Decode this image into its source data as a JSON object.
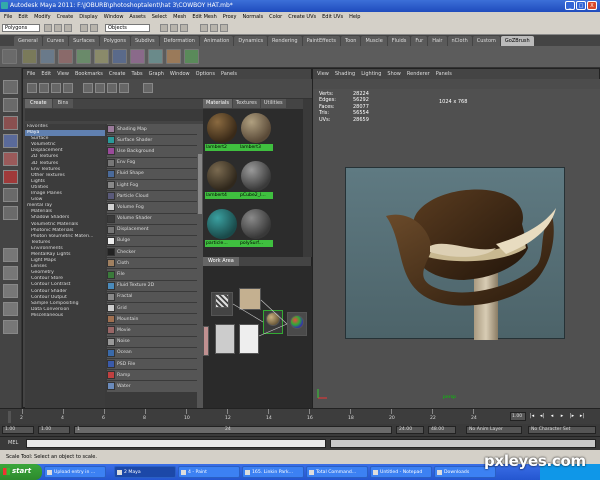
{
  "window": {
    "title": "Autodesk Maya 2011: F:\\JOBURB\\photoshoptalent\\hat 3\\COWBOY HAT.mb*",
    "min": "_",
    "max": "□",
    "close": "X"
  },
  "menubar": [
    "File",
    "Edit",
    "Modify",
    "Create",
    "Display",
    "Window",
    "Assets",
    "Select",
    "Mesh",
    "Edit Mesh",
    "Proxy",
    "Normals",
    "Color",
    "Create UVs",
    "Edit UVs",
    "Help"
  ],
  "statusline": {
    "mode": "Polygons",
    "search_label": "Objects"
  },
  "shelf_tabs": [
    "General",
    "Curves",
    "Surfaces",
    "Polygons",
    "Subdivs",
    "Deformation",
    "Animation",
    "Dynamics",
    "Rendering",
    "PaintEffects",
    "Toon",
    "Muscle",
    "Fluids",
    "Fur",
    "Hair",
    "nCloth",
    "Custom",
    "GoZBrush"
  ],
  "shelf_active": "GoZBrush",
  "hypershade": {
    "menu": [
      "File",
      "Edit",
      "View",
      "Bookmarks",
      "Create",
      "Tabs",
      "Graph",
      "Window",
      "Options",
      "Panels"
    ],
    "create_tabs": [
      "Create",
      "Bins"
    ],
    "tree": [
      {
        "label": "Favorites",
        "level": 0
      },
      {
        "label": "Maya",
        "level": 0,
        "selected": true
      },
      {
        "label": "Surface",
        "level": 1
      },
      {
        "label": "Volumetric",
        "level": 1
      },
      {
        "label": "Displacement",
        "level": 1
      },
      {
        "label": "2D Textures",
        "level": 1
      },
      {
        "label": "3D Textures",
        "level": 1
      },
      {
        "label": "Env Textures",
        "level": 1
      },
      {
        "label": "Other Textures",
        "level": 1
      },
      {
        "label": "Lights",
        "level": 1
      },
      {
        "label": "Utilities",
        "level": 1
      },
      {
        "label": "Image Planes",
        "level": 1
      },
      {
        "label": "Glow",
        "level": 1
      },
      {
        "label": "mental ray",
        "level": 0
      },
      {
        "label": "Materials",
        "level": 1
      },
      {
        "label": "Shadow Shaders",
        "level": 1
      },
      {
        "label": "Volumetric Materials",
        "level": 1
      },
      {
        "label": "Photonic Materials",
        "level": 1
      },
      {
        "label": "Photon Volumetric Materi...",
        "level": 1
      },
      {
        "label": "Textures",
        "level": 1
      },
      {
        "label": "Environments",
        "level": 1
      },
      {
        "label": "MentalRay Lights",
        "level": 1
      },
      {
        "label": "Light Maps",
        "level": 1
      },
      {
        "label": "Lenses",
        "level": 1
      },
      {
        "label": "Geometry",
        "level": 1
      },
      {
        "label": "Contour Store",
        "level": 1
      },
      {
        "label": "Contour Contrast",
        "level": 1
      },
      {
        "label": "Contour Shader",
        "level": 1
      },
      {
        "label": "Contour Output",
        "level": 1
      },
      {
        "label": "Sample Compositing",
        "level": 1
      },
      {
        "label": "Data Conversion",
        "level": 1
      },
      {
        "label": "Miscellaneous",
        "level": 1
      }
    ],
    "nodes": [
      {
        "label": "Shading Map",
        "color": "#9a7a9a"
      },
      {
        "label": "Surface Shader",
        "color": "#2a9a9a"
      },
      {
        "label": "Use Background",
        "color": "#9a4a9a"
      },
      {
        "label": "Env Fog",
        "color": "#777777"
      },
      {
        "label": "Fluid Shape",
        "color": "#4a6a9a"
      },
      {
        "label": "Light Fog",
        "color": "#888888"
      },
      {
        "label": "Particle Cloud",
        "color": "#5a5a7a"
      },
      {
        "label": "Volume Fog",
        "color": "#d0d0d0"
      },
      {
        "label": "Volume Shader",
        "color": "#3a3a3a"
      },
      {
        "label": "Displacement",
        "color": "#777777"
      },
      {
        "label": "Bulge",
        "color": "#eeeeee"
      },
      {
        "label": "Checker",
        "color": "#222222"
      },
      {
        "label": "Cloth",
        "color": "#a08060"
      },
      {
        "label": "File",
        "color": "#3a7a3a"
      },
      {
        "label": "Fluid Texture 2D",
        "color": "#4a8aba"
      },
      {
        "label": "Fractal",
        "color": "#888888"
      },
      {
        "label": "Grid",
        "color": "#cccccc"
      },
      {
        "label": "Mountain",
        "color": "#a07050"
      },
      {
        "label": "Movie",
        "color": "#996666"
      },
      {
        "label": "Noise",
        "color": "#999999"
      },
      {
        "label": "Ocean",
        "color": "#3a6aaa"
      },
      {
        "label": "PSD File",
        "color": "#3a5aaa"
      },
      {
        "label": "Ramp",
        "color": "#c04040"
      },
      {
        "label": "Water",
        "color": "#6a8aba"
      }
    ],
    "mat_tabs": [
      "Materials",
      "Textures",
      "Utilities"
    ],
    "swatches": [
      {
        "label": "lambert2",
        "color": "#3a2a18",
        "hl": "#8a6a40"
      },
      {
        "label": "lambert3",
        "color": "#5a4a38",
        "hl": "#b0a080"
      },
      {
        "label": "lambert4",
        "color": "#30281c",
        "hl": "#7a6a50"
      },
      {
        "label": "pCube2_l...",
        "color": "#3a3a3a",
        "hl": "#9a9a9a"
      },
      {
        "label": "particle...",
        "color": "#1a4a4a",
        "hl": "#3aa0a0"
      },
      {
        "label": "polySurf...",
        "color": "#383838",
        "hl": "#8a8a8a"
      }
    ],
    "work_tab": "Work Area"
  },
  "viewport": {
    "menu": [
      "View",
      "Shading",
      "Lighting",
      "Show",
      "Renderer",
      "Panels"
    ],
    "hud": [
      {
        "k": "Verts:",
        "v": "28224"
      },
      {
        "k": "Edges:",
        "v": "56292"
      },
      {
        "k": "Faces:",
        "v": "28077"
      },
      {
        "k": "Tris:",
        "v": "56554"
      },
      {
        "k": "UVs:",
        "v": "28659"
      }
    ],
    "resolution": "1024 x 768",
    "camera": "persp"
  },
  "timeline": {
    "ticks": [
      "2",
      "4",
      "6",
      "8",
      "10",
      "12",
      "14",
      "16",
      "18",
      "20",
      "22",
      "24"
    ],
    "current": "1.00"
  },
  "range": {
    "start": "1.00",
    "inner_start": "1.00",
    "frame": "1",
    "inner_end": "24",
    "end": "24.00",
    "end2": "48.00",
    "anim_layer": "No Anim Layer",
    "char_set": "No Character Set"
  },
  "cmdline": {
    "label": "MEL"
  },
  "helpline": {
    "text": "Scale Tool: Select an object to scale."
  },
  "taskbar": {
    "start": "start",
    "items": [
      {
        "label": "Upload entry in ...",
        "active": false
      },
      {
        "label": "2 Maya",
        "active": true
      },
      {
        "label": "4 - Paint",
        "active": false
      },
      {
        "label": "165. Linkin Park...",
        "active": false
      },
      {
        "label": "Total Command...",
        "active": false
      },
      {
        "label": "Untitled - Notepad",
        "active": false
      },
      {
        "label": "Downloads",
        "active": false
      }
    ]
  },
  "watermark": "pxleyes.com"
}
